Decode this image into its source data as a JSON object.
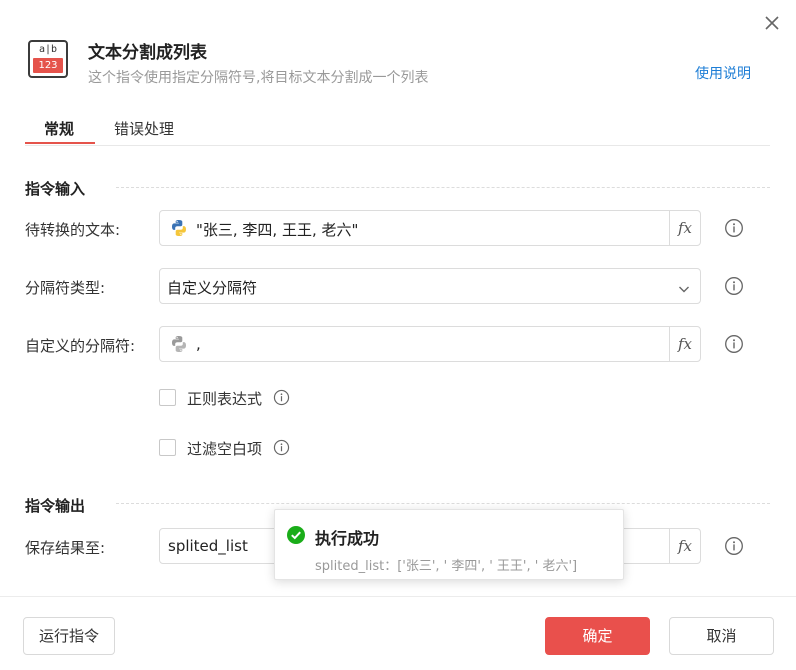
{
  "dialog": {
    "title": "文本分割成列表",
    "subtitle": "这个指令使用指定分隔符号,将目标文本分割成一个列表",
    "help_link": "使用说明",
    "icon_top_text": "a|b",
    "icon_bottom_text": "123"
  },
  "tabs": [
    {
      "label": "常规",
      "active": true
    },
    {
      "label": "错误处理",
      "active": false
    }
  ],
  "input_section": {
    "title": "指令输入",
    "fields": [
      {
        "label": "待转换的文本:",
        "value": "\"张三, 李四, 王王, 老六\"",
        "icon": "python-icon"
      },
      {
        "label": "分隔符类型:",
        "value": "自定义分隔符",
        "icon": "chevron-down-icon"
      },
      {
        "label": "自定义的分隔符:",
        "value": ",",
        "icon": "python-icon"
      }
    ],
    "checkboxes": [
      {
        "label": "正则表达式",
        "checked": false
      },
      {
        "label": "过滤空白项",
        "checked": false
      }
    ]
  },
  "output_section": {
    "title": "指令输出",
    "field": {
      "label": "保存结果至:",
      "value": "splited_list"
    }
  },
  "toast": {
    "title": "执行成功",
    "message": "splited_list：['张三', ' 李四', ' 王王', ' 老六']",
    "status_color": "#1aad19"
  },
  "footer": {
    "run_label": "运行指令",
    "ok_label": "确定",
    "cancel_label": "取消"
  },
  "colors": {
    "accent": "#e9504c",
    "link": "#1e7ed6"
  }
}
